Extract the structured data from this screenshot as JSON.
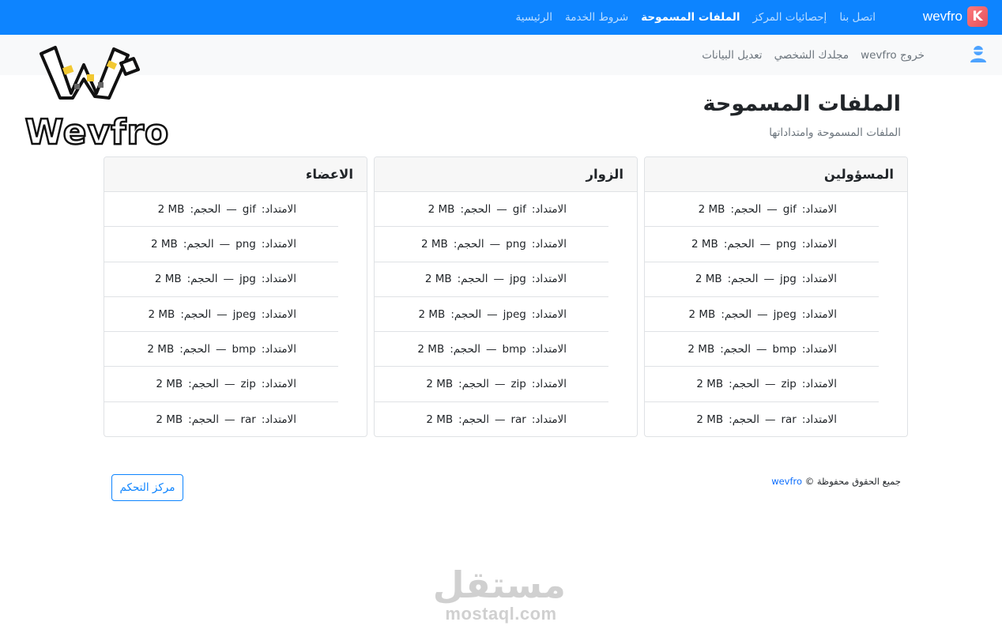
{
  "topbar": {
    "brand": "wevfro",
    "brand_icon": "K",
    "nav": [
      {
        "label": "الرئيسية",
        "active": false
      },
      {
        "label": "شروط الخدمة",
        "active": false
      },
      {
        "label": "الملفات المسموحة",
        "active": true
      },
      {
        "label": "إحصائيات المركز",
        "active": false
      },
      {
        "label": "اتصل بنا",
        "active": false
      }
    ],
    "accent": "#0d84ff"
  },
  "subbar": {
    "icon": "user-icon",
    "nav": [
      {
        "label": "تعديل البيانات"
      },
      {
        "label": "مجلدك الشخصي"
      },
      {
        "label": "خروج  wevfro"
      }
    ]
  },
  "logo": {
    "text": "Wevfro",
    "icon": "w-logo"
  },
  "page": {
    "title": "الملفات المسموحة",
    "subtitle": "الملفات المسموحة وامتداداتها"
  },
  "labels": {
    "ext": "الامتداد:",
    "size": "الحجم:",
    "dash": "—"
  },
  "groups": [
    {
      "title": "المسؤولين",
      "rows": [
        {
          "ext": "gif",
          "size": "2 MB"
        },
        {
          "ext": "png",
          "size": "2 MB"
        },
        {
          "ext": "jpg",
          "size": "2 MB"
        },
        {
          "ext": "jpeg",
          "size": "2 MB"
        },
        {
          "ext": "bmp",
          "size": "2 MB"
        },
        {
          "ext": "zip",
          "size": "2 MB"
        },
        {
          "ext": "rar",
          "size": "2 MB"
        }
      ]
    },
    {
      "title": "الزوار",
      "rows": [
        {
          "ext": "gif",
          "size": "2 MB"
        },
        {
          "ext": "png",
          "size": "2 MB"
        },
        {
          "ext": "jpg",
          "size": "2 MB"
        },
        {
          "ext": "jpeg",
          "size": "2 MB"
        },
        {
          "ext": "bmp",
          "size": "2 MB"
        },
        {
          "ext": "zip",
          "size": "2 MB"
        },
        {
          "ext": "rar",
          "size": "2 MB"
        }
      ]
    },
    {
      "title": "الاعضاء",
      "rows": [
        {
          "ext": "gif",
          "size": "2 MB"
        },
        {
          "ext": "png",
          "size": "2 MB"
        },
        {
          "ext": "jpg",
          "size": "2 MB"
        },
        {
          "ext": "jpeg",
          "size": "2 MB"
        },
        {
          "ext": "bmp",
          "size": "2 MB"
        },
        {
          "ext": "zip",
          "size": "2 MB"
        },
        {
          "ext": "rar",
          "size": "2 MB"
        }
      ]
    }
  ],
  "footer": {
    "copyright_text": "جميع الحقوق محفوظة ©",
    "copyright_link": "wevfro",
    "control_button": "مركز التحكم"
  },
  "watermark": {
    "arabic": "مستقل",
    "latin": "mostaql.com"
  }
}
